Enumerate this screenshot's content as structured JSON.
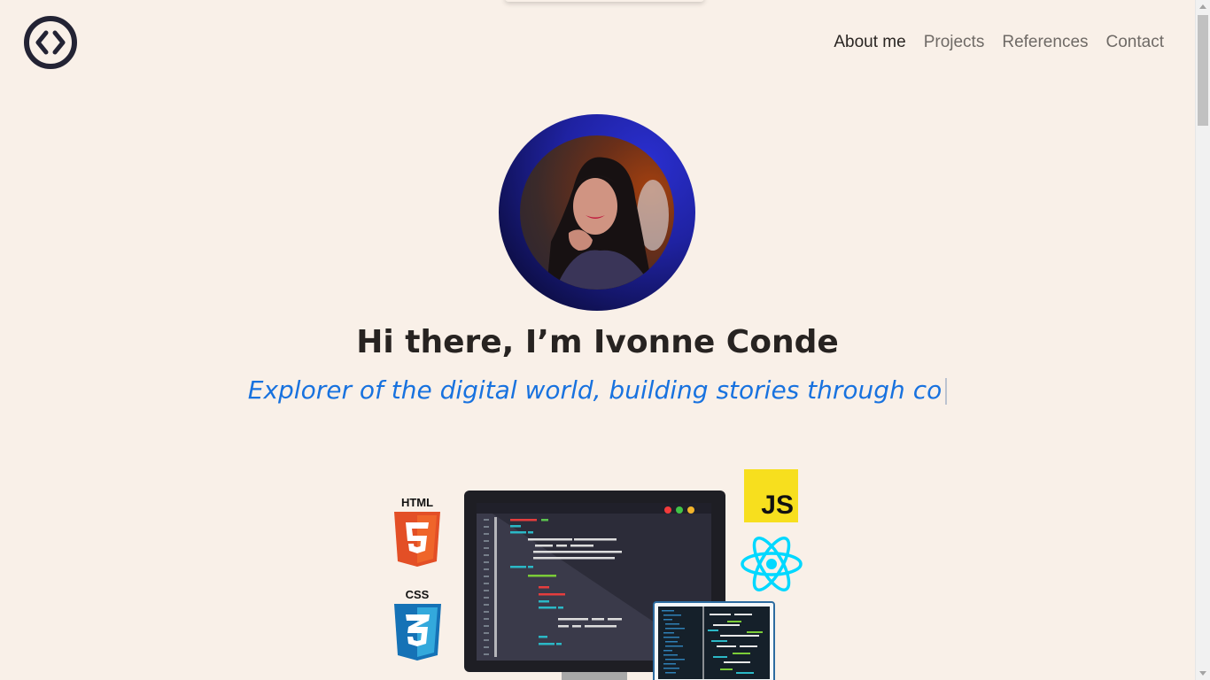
{
  "header": {
    "logo_icon": "code-brackets-circle-icon",
    "nav": [
      {
        "label": "About me",
        "active": true
      },
      {
        "label": "Projects",
        "active": false
      },
      {
        "label": "References",
        "active": false
      },
      {
        "label": "Contact",
        "active": false
      }
    ]
  },
  "hero": {
    "avatar_icon": "profile-photo",
    "title": "Hi there, I’m Ivonne Conde",
    "subtitle": "Explorer of the digital world, building stories through co"
  },
  "tech_stack": {
    "html_label": "HTML",
    "css_label": "CSS",
    "js_label": "JS",
    "html_number": "5",
    "css_number": "3",
    "react_icon": "react-atom-icon"
  },
  "colors": {
    "background": "#f9f0e8",
    "accent_text": "#1872df",
    "heading_text": "#272321",
    "html_orange": "#e34f26",
    "css_blue": "#1572b6",
    "js_yellow": "#f7df1e",
    "react_cyan": "#00d8ff"
  }
}
